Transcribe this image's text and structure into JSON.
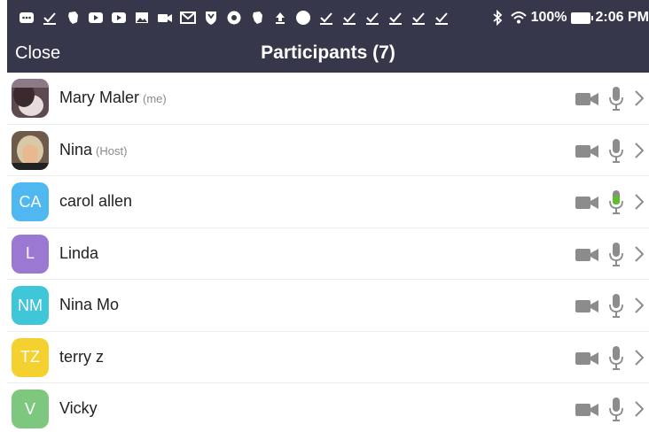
{
  "status_bar": {
    "battery": "100%",
    "time": "2:06 PM",
    "icons": [
      "more-icon",
      "check-icon",
      "evernote-icon",
      "youtube-icon",
      "youtube-icon",
      "image-icon",
      "video-icon",
      "gmail-icon",
      "shield-icon",
      "chrome-icon",
      "evernote-icon",
      "upload-icon",
      "circle-icon",
      "check-icon",
      "check-icon",
      "check-icon",
      "check-icon",
      "check-icon",
      "check-icon"
    ]
  },
  "header": {
    "close_label": "Close",
    "title": "Participants (7)"
  },
  "participants": [
    {
      "name": "Mary Maler",
      "tag": "(me)",
      "avatar_initials": "",
      "avatar_type": "photo",
      "avatar_color": "#7a5a48",
      "mic_active": false
    },
    {
      "name": "Nina",
      "tag": "(Host)",
      "avatar_initials": "",
      "avatar_type": "photo",
      "avatar_color": "#b08a60",
      "mic_active": false
    },
    {
      "name": "carol allen",
      "tag": "",
      "avatar_initials": "CA",
      "avatar_type": "initials",
      "avatar_color": "#4fb8f0",
      "mic_active": true
    },
    {
      "name": "Linda",
      "tag": "",
      "avatar_initials": "L",
      "avatar_type": "initials",
      "avatar_color": "#9b78d2",
      "mic_active": false
    },
    {
      "name": "Nina Mo",
      "tag": "",
      "avatar_initials": "NM",
      "avatar_type": "initials",
      "avatar_color": "#3fc6d8",
      "mic_active": false
    },
    {
      "name": "terry z",
      "tag": "",
      "avatar_initials": "TZ",
      "avatar_type": "initials",
      "avatar_color": "#f5d130",
      "mic_active": false
    },
    {
      "name": "Vicky",
      "tag": "",
      "avatar_initials": "V",
      "avatar_type": "initials",
      "avatar_color": "#7ec77e",
      "mic_active": false
    }
  ],
  "colors": {
    "header_bg": "#36374a",
    "icon_gray": "#8c8c8c",
    "mic_active": "#5bbf2a"
  }
}
